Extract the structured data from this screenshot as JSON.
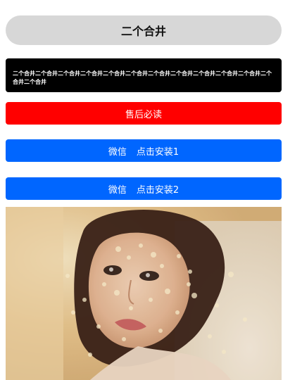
{
  "header": {
    "title": "二个合井"
  },
  "notice": {
    "text": "二个合井二个合井二个合井二个合井二个合井二个合井二个合井二个合井二个合井二个合井二个合井二个合井二个合井"
  },
  "buttons": {
    "after_sales": "售后必读",
    "wechat1_prefix": "微信",
    "wechat1_label": "点击安装1",
    "wechat2_prefix": "微信",
    "wechat2_label": "点击安装2"
  },
  "colors": {
    "title_bg": "#d7d7d7",
    "notice_bg": "#000000",
    "after_sales_bg": "#ff0000",
    "wechat_bg": "#0066ff"
  }
}
